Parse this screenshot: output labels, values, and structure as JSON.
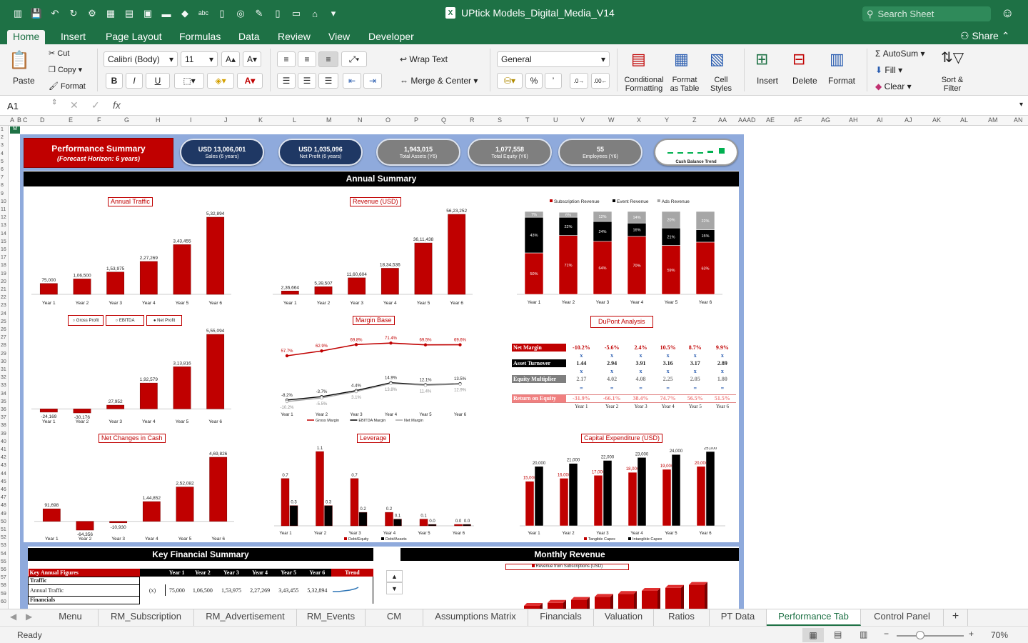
{
  "app": {
    "file_name": "UPtick Models_Digital_Media_V14",
    "search_placeholder": "Search Sheet",
    "share_label": "Share",
    "status": "Ready",
    "zoom": "70%"
  },
  "ribbon_tabs": [
    "Home",
    "Insert",
    "Page Layout",
    "Formulas",
    "Data",
    "Review",
    "View",
    "Developer"
  ],
  "ribbon": {
    "paste": "Paste",
    "cut": "Cut",
    "copy": "Copy",
    "format": "Format",
    "font_name": "Calibri (Body)",
    "font_size": "11",
    "bold": "B",
    "italic": "I",
    "underline": "U",
    "wrap_text": "Wrap Text",
    "merge_center": "Merge & Center",
    "number_format": "General",
    "percent": "%",
    "comma": "’",
    "cond_format_1": "Conditional",
    "cond_format_2": "Formatting",
    "format_table_1": "Format",
    "format_table_2": "as Table",
    "cell_styles_1": "Cell",
    "cell_styles_2": "Styles",
    "insert": "Insert",
    "delete": "Delete",
    "format_cells": "Format",
    "autosum": "AutoSum",
    "fill": "Fill",
    "clear": "Clear",
    "sort_1": "Sort &",
    "sort_2": "Filter"
  },
  "formula_bar": {
    "cell_ref": "A1",
    "fx": "fx",
    "value": ""
  },
  "columns": [
    "A",
    "B",
    "C",
    "D",
    "E",
    "F",
    "G",
    "H",
    "I",
    "J",
    "K",
    "L",
    "M",
    "N",
    "O",
    "P",
    "Q",
    "R",
    "S",
    "T",
    "U",
    "V",
    "W",
    "X",
    "Y",
    "Z",
    "AA",
    "AAAD",
    "AE",
    "AF",
    "AG",
    "AH",
    "AI",
    "AJ",
    "AK",
    "AL",
    "AM",
    "AN"
  ],
  "dashboard": {
    "title": "Performance Summary",
    "subtitle": "(Forecast Horizon: 6 years)",
    "kpis": [
      {
        "value": "USD 13,006,001",
        "label": "Sales (6 years)",
        "color": "#1f3864"
      },
      {
        "value": "USD 1,035,096",
        "label": "Net Profit (6 years)",
        "color": "#1f3864"
      },
      {
        "value": "1,943,015",
        "label": "Total Assets (Y6)",
        "color": "#7f7f7f"
      },
      {
        "value": "1,077,558",
        "label": "Total Equity (Y6)",
        "color": "#7f7f7f"
      },
      {
        "value": "55",
        "label": "Employees (Y6)",
        "color": "#7f7f7f"
      }
    ],
    "cash_trend_label": "Cash Balance Trend",
    "annual_summary": "Annual Summary",
    "key_financial_summary": "Key Financial Summary",
    "monthly_revenue": "Monthly Revenue",
    "monthly_revenue_legend": "Revenue from Subscriptions (USD)"
  },
  "chart_data": [
    {
      "type": "bar",
      "title": "Annual Traffic",
      "categories": [
        "Year 1",
        "Year 2",
        "Year 3",
        "Year 4",
        "Year 5",
        "Year 6"
      ],
      "values": [
        75000,
        106500,
        153975,
        227269,
        343455,
        532894
      ],
      "labels": [
        "75,000",
        "1,06,500",
        "1,53,975",
        "2,27,269",
        "3,43,455",
        "5,32,894"
      ]
    },
    {
      "type": "bar",
      "title": "Revenue (USD)",
      "categories": [
        "Year 1",
        "Year 2",
        "Year 3",
        "Year 4",
        "Year 5",
        "Year 6"
      ],
      "values": [
        236664,
        539507,
        1160604,
        1834536,
        3611438,
        5623252
      ],
      "labels": [
        "2,36,664",
        "5,39,507",
        "11,60,604",
        "18,34,536",
        "36,11,438",
        "56,23,252"
      ]
    },
    {
      "type": "bar",
      "title": "",
      "stacked": true,
      "categories": [
        "Year 1",
        "Year 2",
        "Year 3",
        "Year 4",
        "Year 5",
        "Year 6"
      ],
      "series": [
        {
          "name": "Subscription Revenue",
          "values": [
            50,
            71,
            64,
            70,
            59,
            63
          ]
        },
        {
          "name": "Event Revenue",
          "values": [
            43,
            22,
            24,
            16,
            21,
            15
          ]
        },
        {
          "name": "Ads Revenue",
          "values": [
            7,
            6,
            12,
            14,
            20,
            22
          ]
        }
      ]
    },
    {
      "type": "bar",
      "title": "",
      "categories": [
        "Year 1",
        "Year 2",
        "Year 3",
        "Year 4",
        "Year 5",
        "Year 6"
      ],
      "values": [
        -24169,
        -30176,
        27952,
        192579,
        313816,
        555094
      ],
      "labels": [
        "-24,169",
        "-30,176",
        "27,952",
        "1,92,579",
        "3,13,816",
        "5,55,094"
      ],
      "options": [
        "Gross Profit",
        "EBITDA",
        "Net Profit"
      ],
      "selected": "Net Profit"
    },
    {
      "type": "line",
      "title": "Margin Base",
      "categories": [
        "Year 1",
        "Year 2",
        "Year 3",
        "Year 4",
        "Year 5",
        "Year 6"
      ],
      "series": [
        {
          "name": "Gross Margin",
          "values": [
            57.7,
            62.9,
            69.8,
            71.4,
            69.5,
            69.6
          ],
          "labels": [
            "57.7%",
            "62.9%",
            "69.8%",
            "71.4%",
            "69.5%",
            "69.6%"
          ]
        },
        {
          "name": "EBITDA Margin",
          "values": [
            -8.2,
            -3.7,
            4.4,
            14.9,
            12.1,
            13.5
          ],
          "labels": [
            "-8.2%",
            "-3.7%",
            "4.4%",
            "14.9%",
            "12.1%",
            "13.5%"
          ]
        },
        {
          "name": "Net Margin",
          "values": [
            -10.2,
            -5.5,
            3.1,
            13.8,
            11.4,
            12.9
          ],
          "labels": [
            "-10.2%",
            "-5.5%",
            "3.1%",
            "13.8%",
            "11.4%",
            "12.9%"
          ]
        }
      ]
    },
    {
      "type": "table",
      "title": "DuPont Analysis",
      "categories": [
        "Year 1",
        "Year 2",
        "Year 3",
        "Year 4",
        "Year 5",
        "Year 6"
      ],
      "rows": [
        {
          "name": "Net Margin",
          "values": [
            "-10.2%",
            "-5.6%",
            "2.4%",
            "10.5%",
            "8.7%",
            "9.9%"
          ]
        },
        {
          "name": "Asset Turnover",
          "values": [
            "1.44",
            "2.94",
            "3.91",
            "3.16",
            "3.17",
            "2.89"
          ]
        },
        {
          "name": "Equity Multiplier",
          "values": [
            "2.17",
            "4.02",
            "4.08",
            "2.25",
            "2.05",
            "1.80"
          ]
        },
        {
          "name": "Return on Equity",
          "values": [
            "-31.9%",
            "-66.1%",
            "38.4%",
            "74.7%",
            "56.5%",
            "51.5%"
          ]
        }
      ],
      "op_x": "x",
      "op_eq": "="
    },
    {
      "type": "bar",
      "title": "Net Changes in Cash",
      "categories": [
        "Year 1",
        "Year 2",
        "Year 3",
        "Year 4",
        "Year 5",
        "Year 6"
      ],
      "values": [
        91698,
        -64356,
        -10930,
        144852,
        252082,
        469826
      ],
      "labels": [
        "91,698",
        "-64,356",
        "-10,930",
        "1,44,852",
        "2,52,082",
        "4,69,826"
      ]
    },
    {
      "type": "bar",
      "title": "Leverage",
      "categories": [
        "Year 1",
        "Year 2",
        "Year 3",
        "Year 4",
        "Year 5",
        "Year 6"
      ],
      "series": [
        {
          "name": "Debt/Equity",
          "values": [
            0.7,
            1.1,
            0.7,
            0.2,
            0.1,
            0.0
          ]
        },
        {
          "name": "Debt/Assets",
          "values": [
            0.3,
            0.3,
            0.2,
            0.1,
            0.0,
            0.0
          ]
        }
      ]
    },
    {
      "type": "bar",
      "title": "Capital Expenditure (USD)",
      "categories": [
        "Year 1",
        "Year 2",
        "Year 3",
        "Year 4",
        "Year 5",
        "Year 6"
      ],
      "series": [
        {
          "name": "Tangible Capex",
          "values": [
            15000,
            16000,
            17000,
            18000,
            19000,
            20000
          ],
          "labels": [
            "15,000",
            "16,000",
            "17,000",
            "18,000",
            "19,000",
            "20,000"
          ]
        },
        {
          "name": "Intangible Capex",
          "values": [
            20000,
            21000,
            22000,
            23000,
            24000,
            25000
          ],
          "labels": [
            "20,000",
            "21,000",
            "22,000",
            "23,000",
            "24,000",
            "25,000"
          ]
        }
      ]
    }
  ],
  "kfs": {
    "header": "Key Annual Figures",
    "years": [
      "Year 1",
      "Year 2",
      "Year 3",
      "Year 4",
      "Year 5",
      "Year 6"
    ],
    "trend": "Trend",
    "section1": "Traffic",
    "row_label": "Annual Traffic",
    "unit": "(x)",
    "values": [
      "75,000",
      "1,06,500",
      "1,53,975",
      "2,27,269",
      "3,43,455",
      "5,32,894"
    ],
    "section2": "Financials"
  },
  "sheet_tabs": [
    "Menu",
    "RM_Subscription",
    "RM_Advertisement",
    "RM_Events",
    "CM",
    "Assumptions Matrix",
    "Financials",
    "Valuation",
    "Ratios",
    "PT Data",
    "Performance Tab",
    "Control Panel"
  ],
  "active_tab": "Performance Tab",
  "colors": {
    "excel_green": "#1e7145",
    "red": "#c00000",
    "navy": "#1f3864",
    "grey": "#7f7f7f",
    "frame": "#8faadc"
  }
}
